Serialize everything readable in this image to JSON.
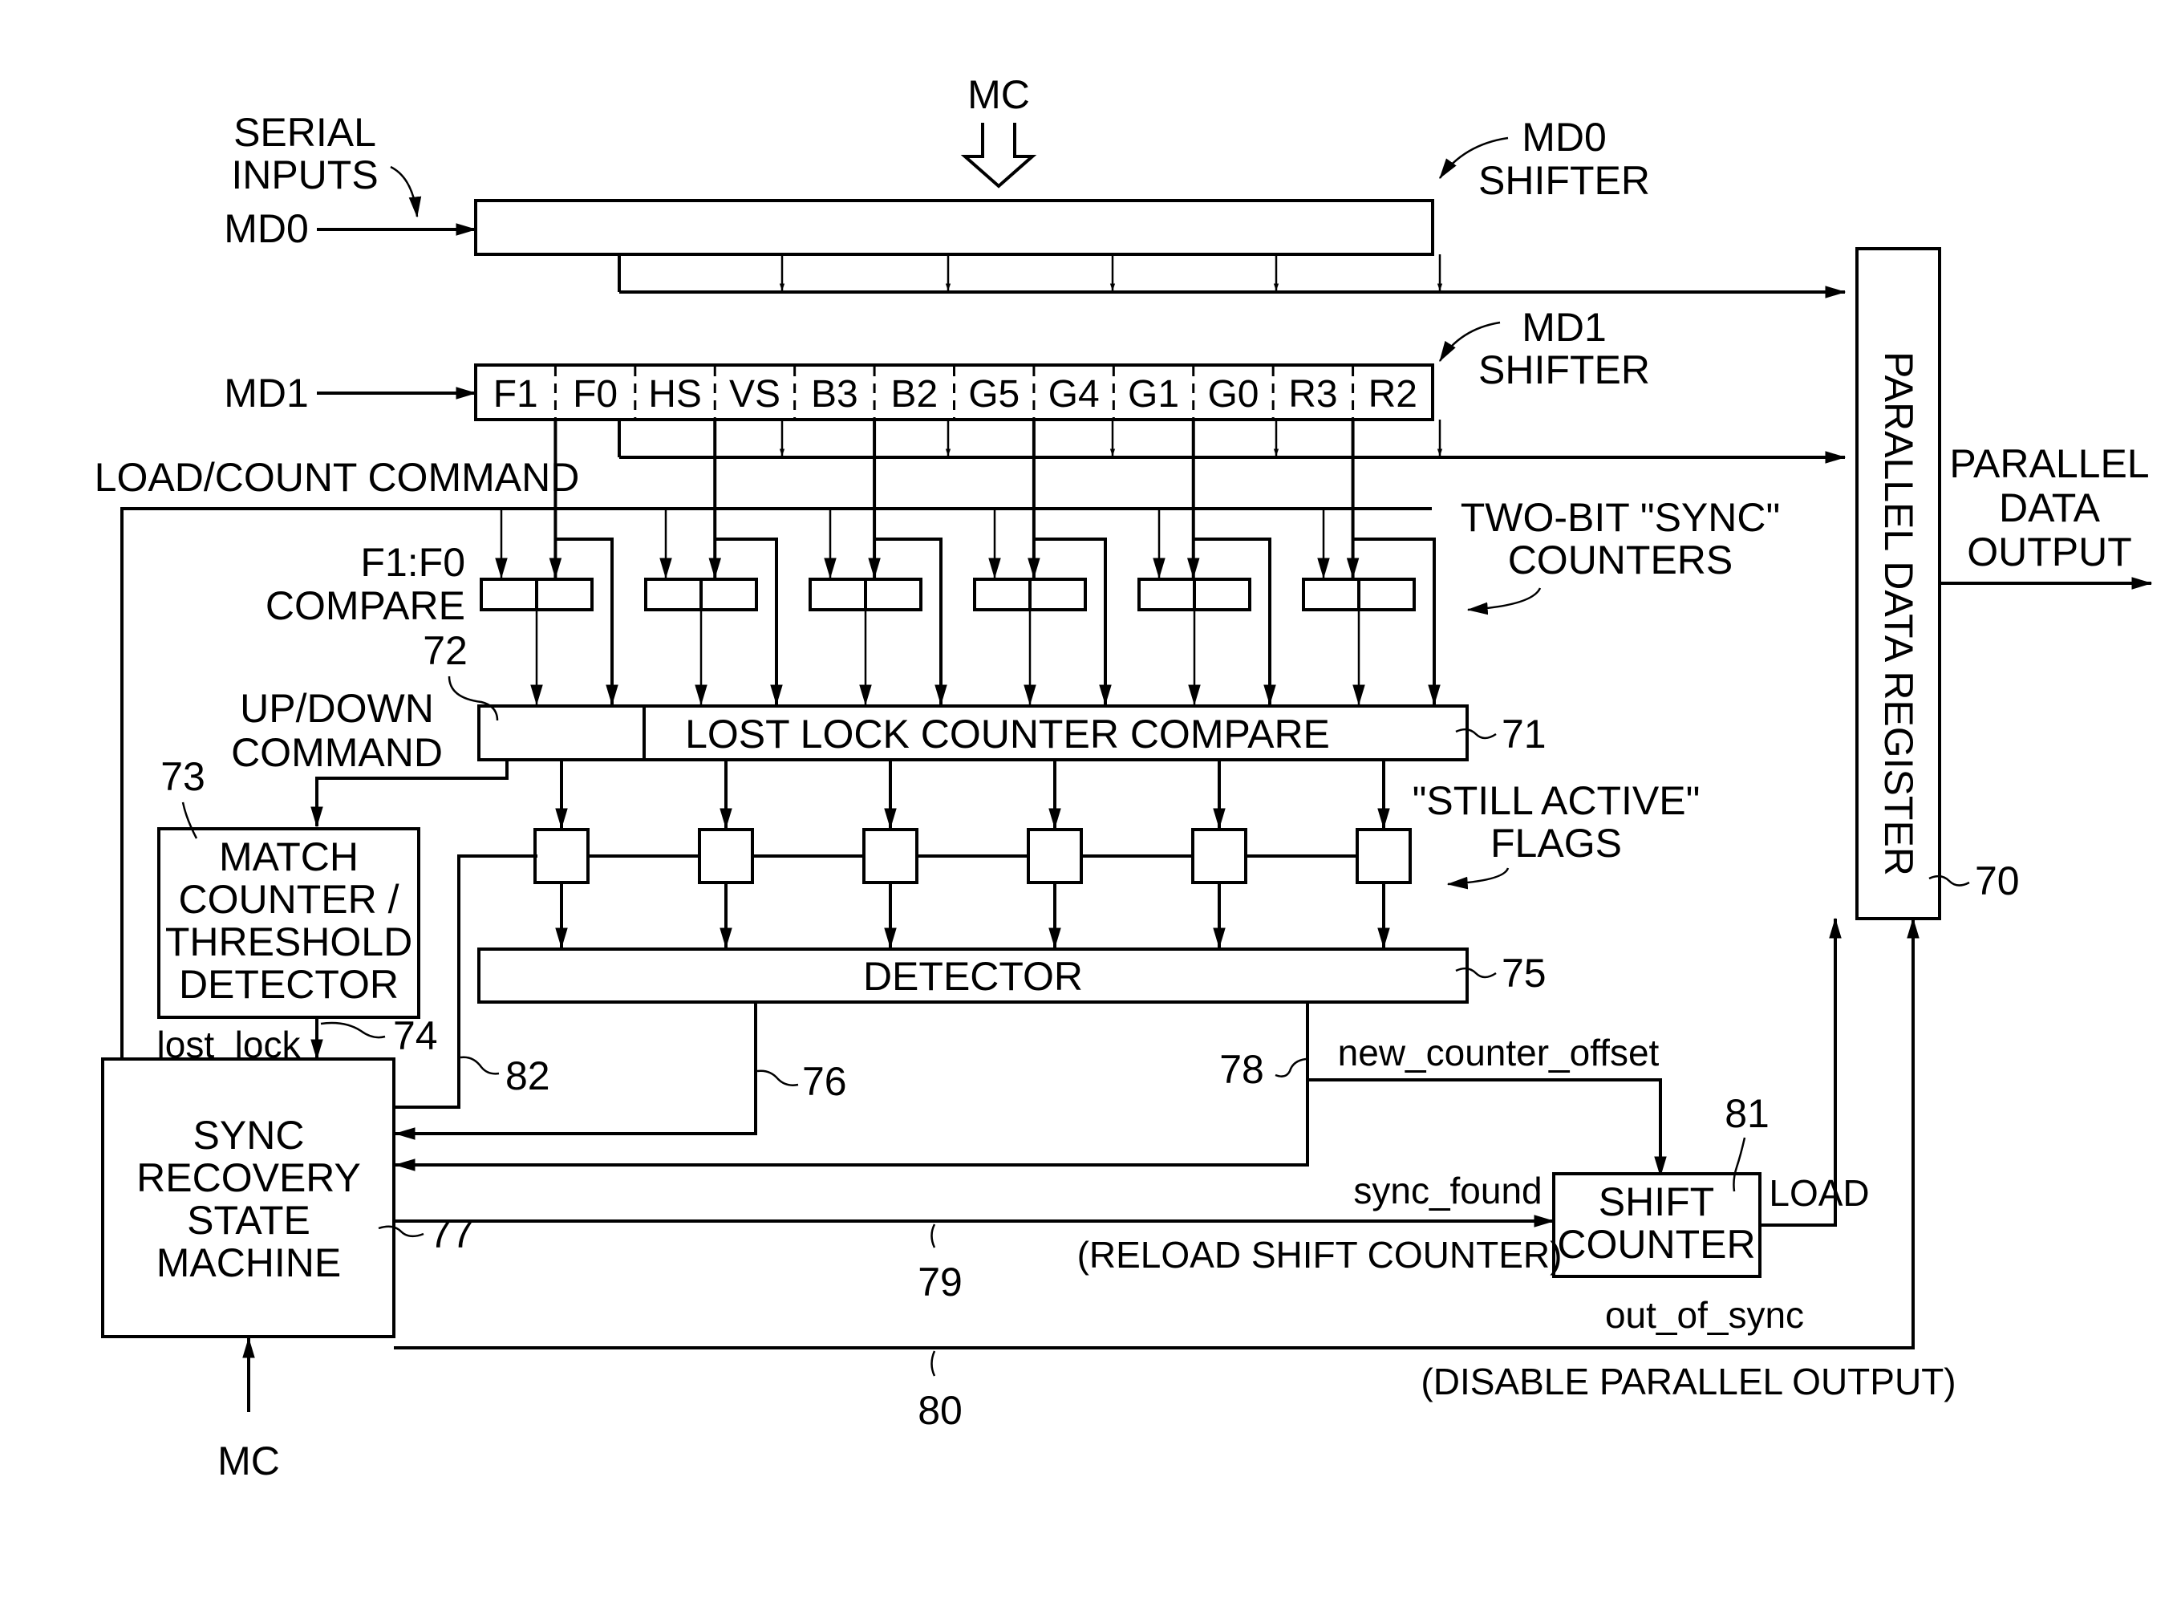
{
  "figure": {
    "inputs": {
      "serial_inputs_label": [
        "SERIAL",
        "INPUTS"
      ],
      "md0": "MD0",
      "md1": "MD1",
      "mc_top": "MC",
      "mc_bottom": "MC"
    },
    "md0_shifter": {
      "label": [
        "MD0",
        "SHIFTER"
      ]
    },
    "md1_shifter": {
      "label": [
        "MD1",
        "SHIFTER"
      ],
      "cells": [
        "F1",
        "F0",
        "HS",
        "VS",
        "B3",
        "B2",
        "G5",
        "G4",
        "G1",
        "G0",
        "R3",
        "R2"
      ]
    },
    "load_count_command": "LOAD/COUNT COMMAND",
    "f1f0_compare": [
      "F1:F0",
      "COMPARE"
    ],
    "two_bit_counters": [
      "TWO-BIT \"SYNC\"",
      "COUNTERS"
    ],
    "up_down_command": [
      "UP/DOWN",
      "COMMAND"
    ],
    "lost_lock_counter_compare": "LOST LOCK COUNTER COMPARE",
    "still_active_flags": [
      "\"STILL ACTIVE\"",
      "FLAGS"
    ],
    "detector": "DETECTOR",
    "match_counter": [
      "MATCH",
      "COUNTER /",
      "THRESHOLD",
      "DETECTOR"
    ],
    "sync_recovery": [
      "SYNC",
      "RECOVERY",
      "STATE",
      "MACHINE"
    ],
    "shift_counter": [
      "SHIFT",
      "COUNTER"
    ],
    "parallel_data_register": "PARALLEL DATA REGISTER",
    "parallel_data_output": [
      "PARALLEL",
      "DATA",
      "OUTPUT"
    ],
    "signals": {
      "lost_lock": "lost_lock",
      "new_counter_offset": "new_counter_offset",
      "sync_found": "sync_found",
      "reload_shift_counter": "(RELOAD SHIFT COUNTER)",
      "load": "LOAD",
      "out_of_sync": "out_of_sync",
      "disable_parallel_output": "(DISABLE PARALLEL OUTPUT)"
    },
    "reference_numerals": {
      "r70": "70",
      "r71": "71",
      "r72": "72",
      "r73": "73",
      "r74": "74",
      "r75": "75",
      "r76": "76",
      "r77": "77",
      "r78": "78",
      "r79": "79",
      "r80": "80",
      "r81": "81",
      "r82": "82"
    }
  }
}
